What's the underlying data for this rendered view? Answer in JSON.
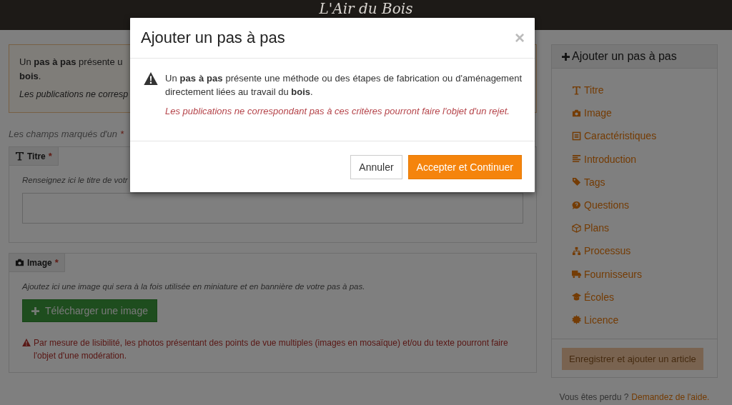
{
  "header": {
    "logo": "L'Air du Bois"
  },
  "intro": {
    "lines": [
      "Un **pas à pas** présente u",
      "**bois**."
    ],
    "note": "Les publications ne corresp"
  },
  "required_note": {
    "text": "Les champs marqués d'un",
    "mark": "*"
  },
  "sections": [
    {
      "kind": "title",
      "label": "Titre",
      "required_mark": "*",
      "help": "Renseignez ici le titre de votr"
    },
    {
      "kind": "image",
      "label": "Image",
      "required_mark": "*",
      "help": "Ajoutez ici une image qui sera à la fois utilisée en miniature et en bannière de votre pas à pas.",
      "button": "Télécharger une image",
      "warning": "Par mesure de lisibilité, les photos présentant des points de vue multiples (images en mosaïque) et/ou du texte pourront faire l'objet d'une modération."
    }
  ],
  "sidebar": {
    "title": "Ajouter un pas à pas",
    "items": [
      {
        "kind": "title",
        "label": "Titre"
      },
      {
        "kind": "image",
        "label": "Image"
      },
      {
        "kind": "features",
        "label": "Caractéristiques"
      },
      {
        "kind": "intro",
        "label": "Introduction"
      },
      {
        "kind": "tags",
        "label": "Tags"
      },
      {
        "kind": "questions",
        "label": "Questions"
      },
      {
        "kind": "plans",
        "label": "Plans"
      },
      {
        "kind": "process",
        "label": "Processus"
      },
      {
        "kind": "suppliers",
        "label": "Fournisseurs"
      },
      {
        "kind": "schools",
        "label": "Écoles"
      },
      {
        "kind": "licence",
        "label": "Licence"
      }
    ],
    "save_button": {
      "label": "Enregistrer et ajouter un article",
      "disabled": true
    },
    "help": {
      "text": "Vous êtes perdu ?",
      "link": "Demandez de l'aide."
    }
  },
  "modal": {
    "title": "Ajouter un pas à pas",
    "close": "×",
    "message": "Un **pas à pas** présente une méthode ou des étapes de fabrication ou d'aménagement directement liées au travail du **bois**.",
    "note": "Les publications ne correspondant pas à ces critères pourront faire l'objet d'un rejet.",
    "buttons": [
      {
        "kind": "default",
        "label": "Annuler"
      },
      {
        "kind": "primary",
        "label": "Accepter et Continuer"
      }
    ]
  }
}
